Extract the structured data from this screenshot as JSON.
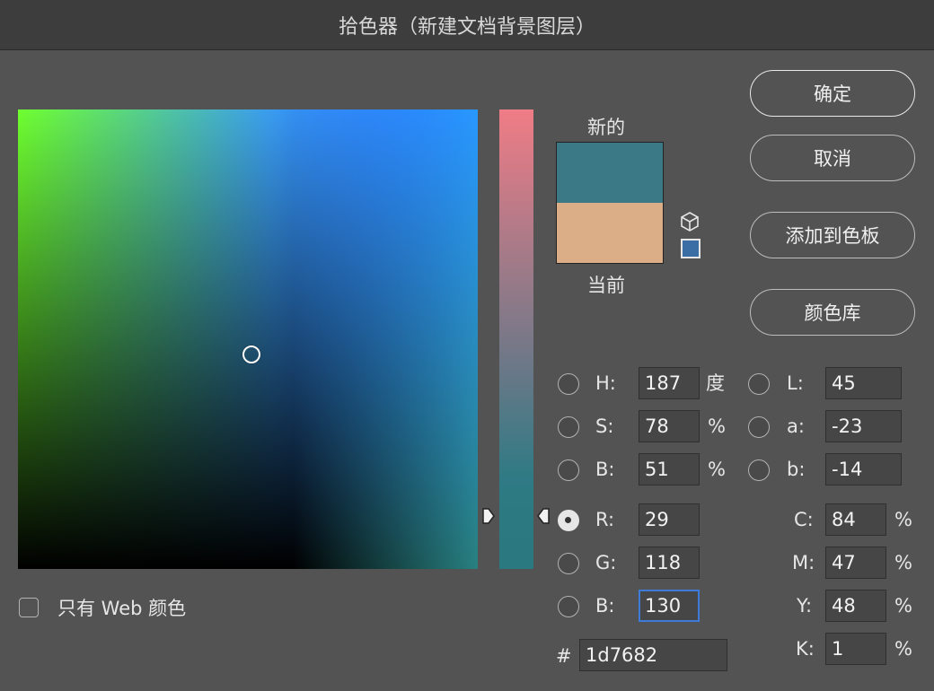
{
  "window": {
    "title": "拾色器（新建文档背景图层）"
  },
  "swatch": {
    "new_label": "新的",
    "current_label": "当前",
    "new_color": "#3a7985",
    "current_color": "#dcae87"
  },
  "buttons": {
    "ok": "确定",
    "cancel": "取消",
    "add_to_swatches": "添加到色板",
    "color_libraries": "颜色库"
  },
  "hsb": {
    "h_label": "H:",
    "h_value": "187",
    "h_unit": "度",
    "s_label": "S:",
    "s_value": "78",
    "s_unit": "%",
    "b_label": "B:",
    "b_value": "51",
    "b_unit": "%"
  },
  "lab": {
    "l_label": "L:",
    "l_value": "45",
    "a_label": "a:",
    "a_value": "-23",
    "b_label": "b:",
    "b_value": "-14"
  },
  "rgb": {
    "r_label": "R:",
    "r_value": "29",
    "g_label": "G:",
    "g_value": "118",
    "b_label": "B:",
    "b_value": "130",
    "selected": "R"
  },
  "cmyk": {
    "c_label": "C:",
    "c_value": "84",
    "m_label": "M:",
    "m_value": "47",
    "y_label": "Y:",
    "y_value": "48",
    "k_label": "K:",
    "k_value": "1",
    "unit": "%"
  },
  "hex": {
    "label": "#",
    "value": "1d7682"
  },
  "options": {
    "web_only_label": "只有 Web 颜色",
    "web_only_checked": false
  },
  "colors": {
    "dialog_bg": "#535353",
    "titlebar_bg": "#3d3d3d",
    "focus_ring": "#3d7ad9",
    "web_safe_swatch": "#3a6ea5"
  },
  "icons": {
    "gamut_warning": "cube-icon",
    "web_safe_warning": "square-icon",
    "slider_handle": "triangle-arrow-icon"
  }
}
